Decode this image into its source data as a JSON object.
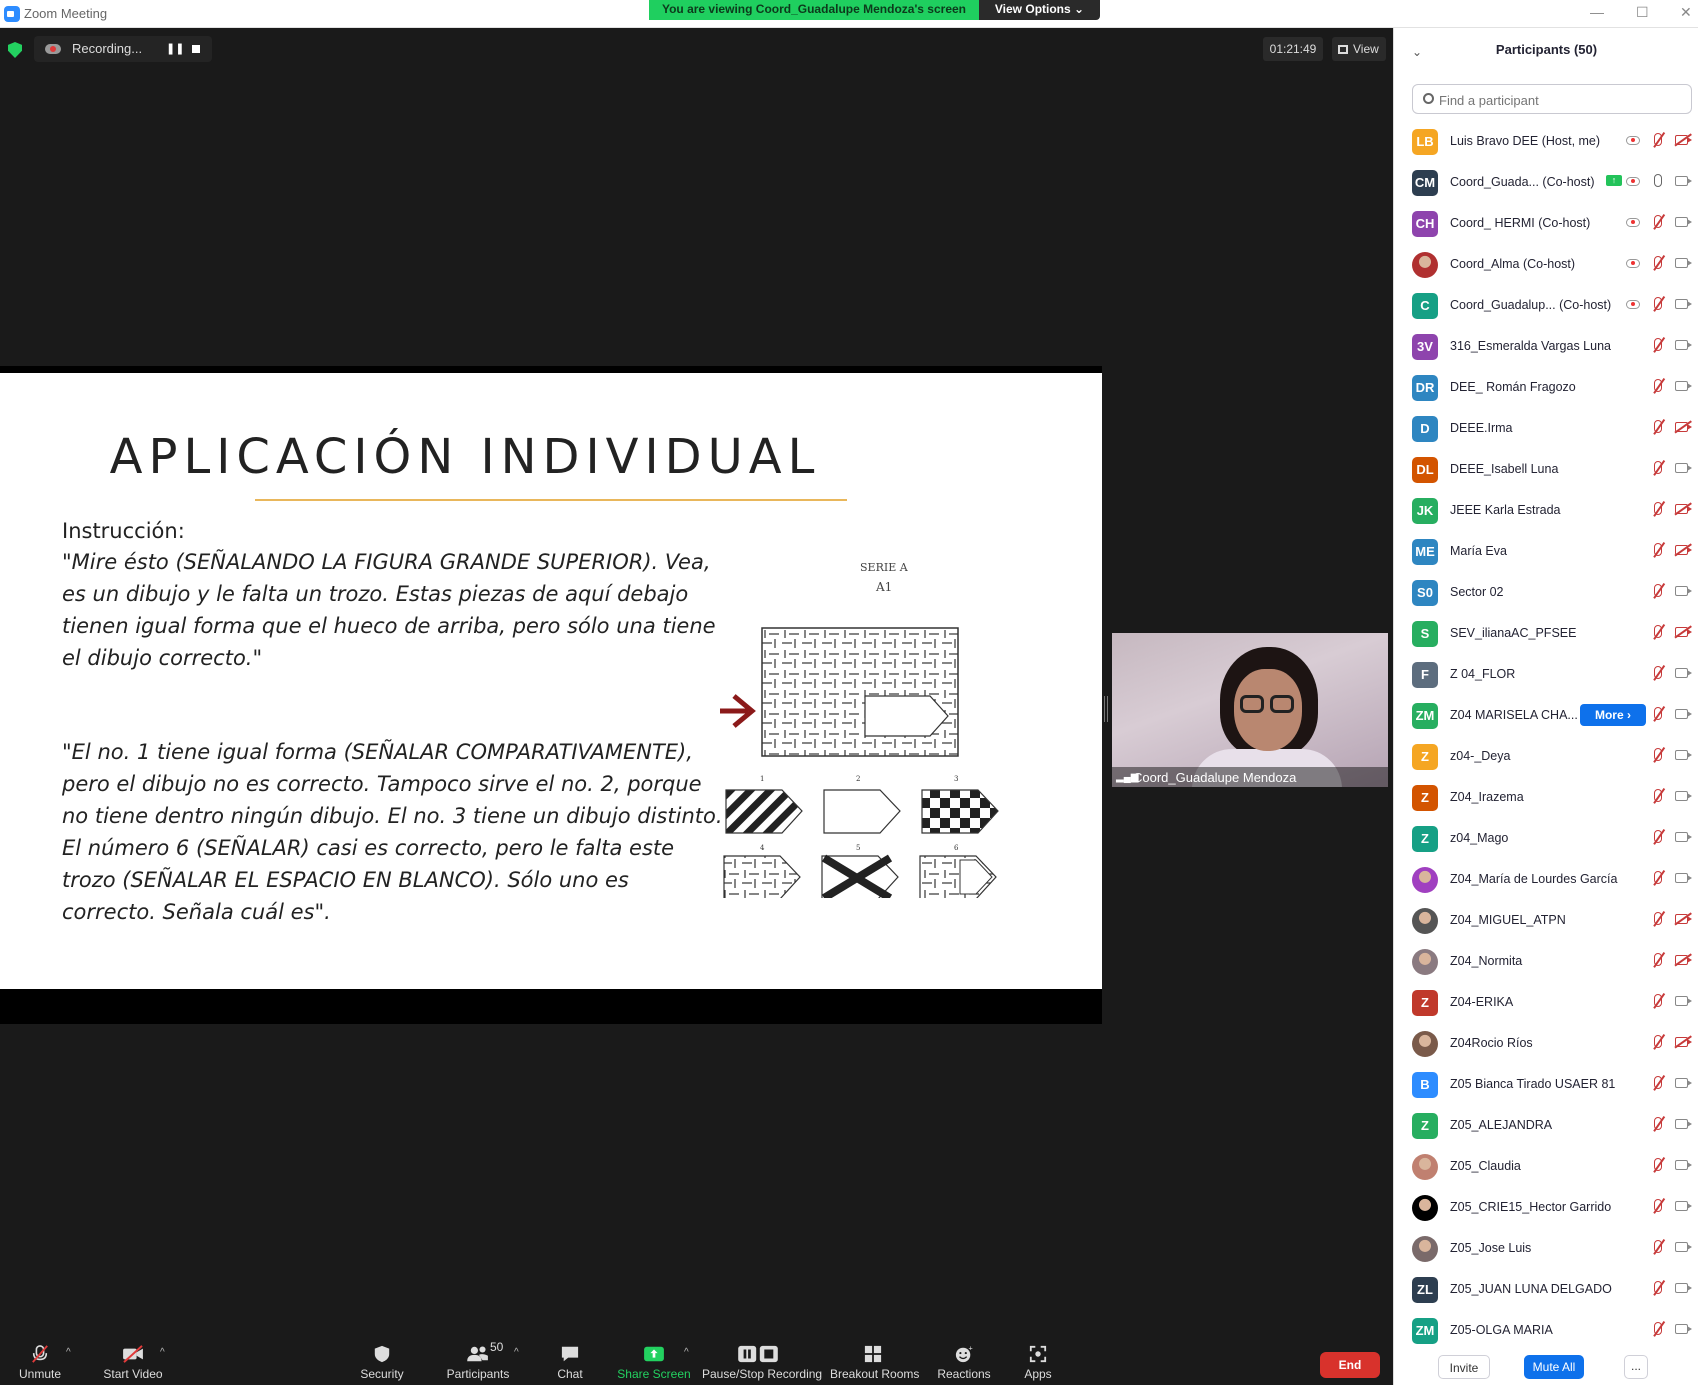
{
  "window": {
    "title": "Zoom Meeting",
    "banner": "You are viewing Coord_Guadalupe Mendoza's screen",
    "view_options": "View Options"
  },
  "topbar": {
    "recording_label": "Recording...",
    "timer": "01:21:49",
    "view_label": "View"
  },
  "slide": {
    "title": "APLICACIÓN INDIVIDUAL",
    "instruction_label": "Instrucción:",
    "paragraph1": "\"Mire ésto (SEÑALANDO LA FIGURA GRANDE SUPERIOR). Vea, es un dibujo y le falta un trozo. Estas piezas de aquí debajo tienen igual forma que el hueco de arriba, pero sólo una tiene el dibujo correcto.\"",
    "paragraph2": "\"El no. 1 tiene igual forma (SEÑALAR COMPARATIVAMENTE), pero el dibujo no es correcto. Tampoco sirve el no. 2, porque no tiene dentro ningún dibujo. El no. 3 tiene un dibujo distinto. El número 6 (SEÑALAR) casi es correcto, pero le falta este trozo (SEÑALAR EL ESPACIO EN BLANCO). Sólo uno es correcto. Señala cuál es\".",
    "figure_series": "SERIE A",
    "figure_item": "A1",
    "option_numbers": [
      "1",
      "2",
      "3",
      "4",
      "5",
      "6"
    ],
    "arrow_color": "#8b1a1a"
  },
  "speaker": {
    "name": "Coord_Guadalupe Mendoza"
  },
  "toolbar": {
    "unmute": "Unmute",
    "start_video": "Start Video",
    "security": "Security",
    "participants": "Participants",
    "participants_count": "50",
    "chat": "Chat",
    "share_screen": "Share Screen",
    "pause_stop_recording": "Pause/Stop Recording",
    "breakout_rooms": "Breakout Rooms",
    "reactions": "Reactions",
    "apps": "Apps",
    "end": "End"
  },
  "panel": {
    "title": "Participants (50)",
    "search_placeholder": "Find a participant",
    "invite": "Invite",
    "mute_all": "Mute All",
    "more_menu": "...",
    "more_button": "More",
    "participants": [
      {
        "initials": "LB",
        "name": "Luis Bravo DEE (Host, me)",
        "color": "#f5a623",
        "recording": true,
        "mic": "muted",
        "cam": "off"
      },
      {
        "initials": "CM",
        "name": "Coord_Guada... (Co-host)",
        "color": "#2d3e50",
        "share": true,
        "recording": true,
        "mic": "on",
        "cam": "on"
      },
      {
        "initials": "CH",
        "name": "Coord_ HERMI (Co-host)",
        "color": "#8e44ad",
        "recording": true,
        "mic": "muted",
        "cam": "on"
      },
      {
        "initials": "",
        "name": "Coord_Alma (Co-host)",
        "color": "#b03030",
        "photo": true,
        "recording": true,
        "mic": "muted",
        "cam": "on"
      },
      {
        "initials": "C",
        "name": "Coord_Guadalup... (Co-host)",
        "color": "#16a085",
        "recording": true,
        "mic": "muted",
        "cam": "on"
      },
      {
        "initials": "3V",
        "name": "316_Esmeralda Vargas Luna",
        "color": "#8e44ad",
        "mic": "muted",
        "cam": "on"
      },
      {
        "initials": "DR",
        "name": "DEE_ Román Fragozo",
        "color": "#2e86c1",
        "mic": "muted",
        "cam": "on"
      },
      {
        "initials": "D",
        "name": "DEEE.Irma",
        "color": "#2e86c1",
        "mic": "muted",
        "cam": "off"
      },
      {
        "initials": "DL",
        "name": "DEEE_Isabell Luna",
        "color": "#d35400",
        "mic": "muted",
        "cam": "on"
      },
      {
        "initials": "JK",
        "name": "JEEE Karla Estrada",
        "color": "#27ae60",
        "mic": "muted",
        "cam": "off"
      },
      {
        "initials": "ME",
        "name": "María Eva",
        "color": "#2e86c1",
        "mic": "muted",
        "cam": "off"
      },
      {
        "initials": "S0",
        "name": "Sector 02",
        "color": "#2e86c1",
        "mic": "muted",
        "cam": "on"
      },
      {
        "initials": "S",
        "name": "SEV_ilianaAC_PFSEE",
        "color": "#27ae60",
        "mic": "muted",
        "cam": "off"
      },
      {
        "initials": "F",
        "name": "Z 04_FLOR",
        "color": "#5d6d7e",
        "mic": "muted",
        "cam": "on"
      },
      {
        "initials": "ZM",
        "name": "Z04 MARISELA CHA...",
        "color": "#27ae60",
        "more": true,
        "mic": "muted",
        "cam": "on"
      },
      {
        "initials": "Z",
        "name": "z04-_Deya",
        "color": "#f5a623",
        "mic": "muted",
        "cam": "on"
      },
      {
        "initials": "Z",
        "name": "Z04_Irazema",
        "color": "#d35400",
        "mic": "muted",
        "cam": "on"
      },
      {
        "initials": "Z",
        "name": "z04_Mago",
        "color": "#16a085",
        "mic": "muted",
        "cam": "on"
      },
      {
        "initials": "",
        "name": "Z04_María de Lourdes García",
        "color": "#a040c0",
        "photo": true,
        "mic": "muted",
        "cam": "on"
      },
      {
        "initials": "",
        "name": "Z04_MIGUEL_ATPN",
        "color": "#555555",
        "photo": true,
        "mic": "muted",
        "cam": "off"
      },
      {
        "initials": "",
        "name": "Z04_Normita",
        "color": "#8a7a80",
        "photo": true,
        "mic": "muted",
        "cam": "off"
      },
      {
        "initials": "Z",
        "name": "Z04-ERIKA",
        "color": "#c0392b",
        "mic": "muted",
        "cam": "on"
      },
      {
        "initials": "",
        "name": "Z04Rocio Ríos",
        "color": "#7a5a4a",
        "photo": true,
        "mic": "muted",
        "cam": "off"
      },
      {
        "initials": "B",
        "name": "Z05 Bianca Tirado USAER 81",
        "color": "#2d8cff",
        "mic": "muted",
        "cam": "on"
      },
      {
        "initials": "Z",
        "name": "Z05_ALEJANDRA",
        "color": "#27ae60",
        "mic": "muted",
        "cam": "on"
      },
      {
        "initials": "",
        "name": "Z05_Claudia",
        "color": "#c08070",
        "photo": true,
        "mic": "muted",
        "cam": "on"
      },
      {
        "initials": "",
        "name": "Z05_CRIE15_Hector Garrido",
        "color": "#000000",
        "photo": true,
        "mic": "muted",
        "cam": "on"
      },
      {
        "initials": "",
        "name": "Z05_Jose Luis",
        "color": "#7a6a6a",
        "photo": true,
        "mic": "muted",
        "cam": "on"
      },
      {
        "initials": "ZL",
        "name": "Z05_JUAN LUNA DELGADO",
        "color": "#2d3e50",
        "mic": "muted",
        "cam": "on"
      },
      {
        "initials": "ZM",
        "name": "Z05-OLGA MARIA",
        "color": "#16a085",
        "mic": "muted",
        "cam": "on"
      }
    ]
  }
}
